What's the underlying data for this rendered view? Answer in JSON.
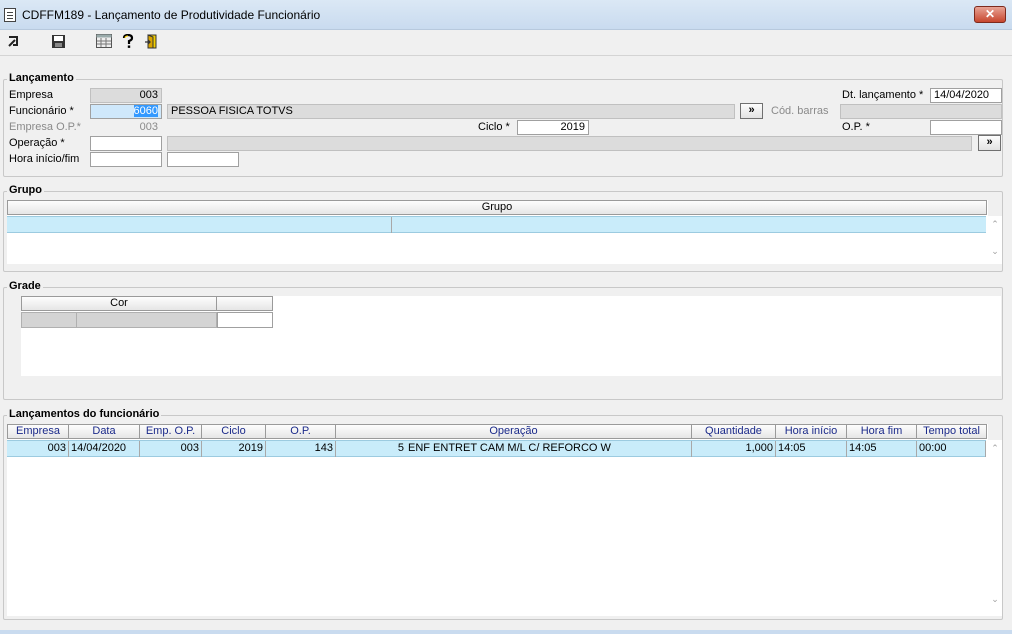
{
  "window": {
    "title": "CDFFM189 - Lançamento de Produtividade Funcionário",
    "close": "✕"
  },
  "toolbar": {
    "icons": [
      "exit-icon",
      "save-icon",
      "calculator-icon",
      "help-icon",
      "door-exit-icon"
    ]
  },
  "lancamento": {
    "legend": "Lançamento",
    "empresa_label": "Empresa",
    "empresa_value": "003",
    "funcionario_label": "Funcionário *",
    "funcionario_code": "6060",
    "funcionario_name": "PESSOA FISICA TOTVS",
    "funcionario_btn": "»",
    "cod_barras_label": "Cód. barras",
    "cod_barras_value": "",
    "empresa_op_label": "Empresa O.P.*",
    "empresa_op_value": "003",
    "ciclo_label": "Ciclo *",
    "ciclo_value": "2019",
    "op_label": "O.P. *",
    "op_value": "",
    "operacao_label": "Operação *",
    "operacao_code": "",
    "operacao_desc": "",
    "operacao_btn": "»",
    "hora_label": "Hora início/fim",
    "hora_inicio": "",
    "hora_fim": "",
    "dt_label": "Dt. lançamento *",
    "dt_value": "14/04/2020"
  },
  "grupo": {
    "legend": "Grupo",
    "column": "Grupo"
  },
  "grade": {
    "legend": "Grade",
    "column": "Cor"
  },
  "lancamentos": {
    "legend": "Lançamentos do funcionário",
    "columns": [
      "Empresa",
      "Data",
      "Emp. O.P.",
      "Ciclo",
      "O.P.",
      "Operação",
      "Quantidade",
      "Hora início",
      "Hora fim",
      "Tempo total"
    ],
    "rows": [
      {
        "empresa": "003",
        "data": "14/04/2020",
        "emp_op": "003",
        "ciclo": "2019",
        "op": "143",
        "op_code": "5",
        "operacao": "ENF ENTRET CAM M/L C/ REFORCO W",
        "quantidade": "1,000",
        "hora_inicio": "14:05",
        "hora_fim": "14:05",
        "tempo_total": "00:00"
      }
    ]
  },
  "colors": {
    "selection": "#c9ecfa",
    "header_text": "#1b2a8a",
    "highlight": "#3399ff"
  }
}
